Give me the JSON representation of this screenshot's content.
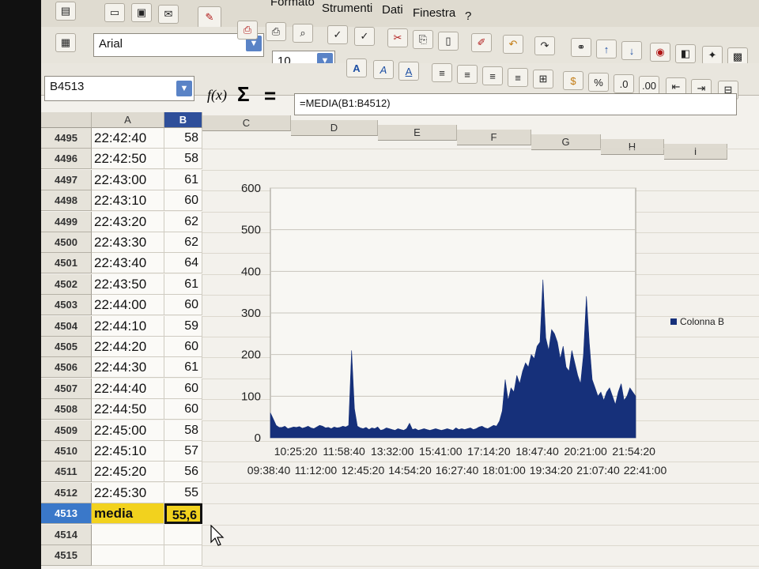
{
  "menu": {
    "items": [
      "Formato",
      "Strumenti",
      "Dati",
      "Finestra",
      "?"
    ]
  },
  "format": {
    "font_name": "Arial",
    "font_size": "10"
  },
  "formula_bar": {
    "cell_ref": "B4513",
    "function_icon": "f(x)",
    "sum_icon": "Σ",
    "equals_icon": "=",
    "formula": "=MEDIA(B1:B4512)"
  },
  "columns": [
    "A",
    "B",
    "C",
    "D",
    "E",
    "F",
    "G",
    "H",
    "I"
  ],
  "rows": [
    {
      "num": "4495",
      "a": "22:42:40",
      "b": "58"
    },
    {
      "num": "4496",
      "a": "22:42:50",
      "b": "58"
    },
    {
      "num": "4497",
      "a": "22:43:00",
      "b": "61"
    },
    {
      "num": "4498",
      "a": "22:43:10",
      "b": "60"
    },
    {
      "num": "4499",
      "a": "22:43:20",
      "b": "62"
    },
    {
      "num": "4500",
      "a": "22:43:30",
      "b": "62"
    },
    {
      "num": "4501",
      "a": "22:43:40",
      "b": "64"
    },
    {
      "num": "4502",
      "a": "22:43:50",
      "b": "61"
    },
    {
      "num": "4503",
      "a": "22:44:00",
      "b": "60"
    },
    {
      "num": "4504",
      "a": "22:44:10",
      "b": "59"
    },
    {
      "num": "4505",
      "a": "22:44:20",
      "b": "60"
    },
    {
      "num": "4506",
      "a": "22:44:30",
      "b": "61"
    },
    {
      "num": "4507",
      "a": "22:44:40",
      "b": "60"
    },
    {
      "num": "4508",
      "a": "22:44:50",
      "b": "60"
    },
    {
      "num": "4509",
      "a": "22:45:00",
      "b": "58"
    },
    {
      "num": "4510",
      "a": "22:45:10",
      "b": "57"
    },
    {
      "num": "4511",
      "a": "22:45:20",
      "b": "56"
    },
    {
      "num": "4512",
      "a": "22:45:30",
      "b": "55"
    },
    {
      "num": "4513",
      "a": "media",
      "b": "55,6"
    },
    {
      "num": "4514",
      "a": "",
      "b": ""
    },
    {
      "num": "4515",
      "a": "",
      "b": ""
    }
  ],
  "selected_row": "4513",
  "colors": {
    "series": "#16307a",
    "media_highlight": "#f2d21e",
    "selected_header": "#3a78c9"
  },
  "chart_data": {
    "type": "area",
    "title": "",
    "xlabel": "",
    "ylabel": "",
    "ylim": [
      0,
      600
    ],
    "yticks": [
      0,
      100,
      200,
      300,
      400,
      500,
      600
    ],
    "grid": true,
    "legend_position": "right",
    "x_tick_labels_row1": [
      "10:25:20",
      "11:58:40",
      "13:32:00",
      "15:41:00",
      "17:14:20",
      "18:47:40",
      "20:21:00",
      "21:54:20"
    ],
    "x_tick_labels_row2": [
      "09:38:40",
      "11:12:00",
      "12:45:20",
      "14:54:20",
      "16:27:40",
      "18:01:00",
      "19:34:20",
      "21:07:40",
      "22:41:00"
    ],
    "series": [
      {
        "name": "Colonna B",
        "values": [
          60,
          45,
          30,
          25,
          25,
          28,
          22,
          24,
          26,
          25,
          27,
          23,
          25,
          28,
          24,
          22,
          26,
          30,
          28,
          24,
          25,
          22,
          26,
          24,
          25,
          28,
          26,
          30,
          210,
          70,
          28,
          24,
          22,
          25,
          20,
          24,
          22,
          26,
          18,
          20,
          24,
          22,
          20,
          18,
          22,
          20,
          18,
          22,
          35,
          20,
          22,
          18,
          20,
          22,
          20,
          18,
          20,
          22,
          20,
          18,
          20,
          22,
          20,
          18,
          24,
          20,
          22,
          20,
          22,
          24,
          20,
          22,
          26,
          28,
          24,
          22,
          26,
          30,
          28,
          40,
          65,
          140,
          90,
          120,
          110,
          150,
          130,
          160,
          180,
          170,
          200,
          190,
          220,
          230,
          380,
          240,
          210,
          260,
          250,
          230,
          190,
          220,
          170,
          160,
          210,
          180,
          150,
          130,
          200,
          340,
          230,
          140,
          120,
          100,
          110,
          90,
          110,
          120,
          100,
          80,
          110,
          130,
          90,
          100,
          120,
          110,
          100
        ]
      }
    ]
  }
}
